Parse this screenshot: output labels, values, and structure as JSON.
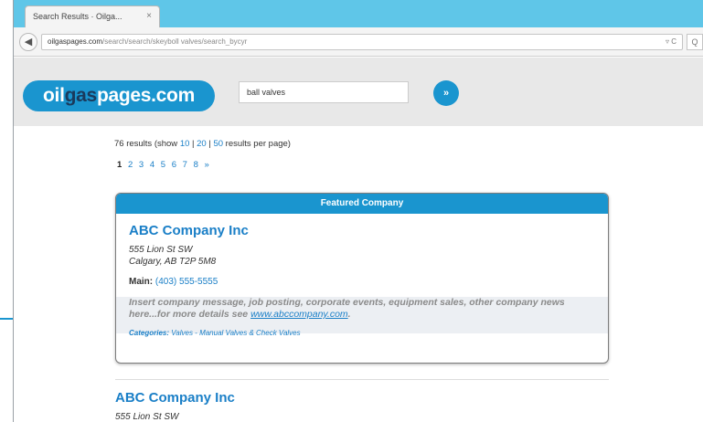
{
  "browser": {
    "tab_title": "Search Results · Oilga...",
    "tab_close": "×",
    "back_icon": "back-arrow-icon",
    "url_host": "oilgaspages.com",
    "url_path": "/search/search/skeyboll valves/search_bycyr",
    "url_tools": "▿ C",
    "url_extra": "Q"
  },
  "site": {
    "logo_part1": "oil",
    "logo_part2": "gas",
    "logo_part3": "pages.com",
    "search_value": "ball valves",
    "search_go_icon": "»",
    "brand_color": "#1a95cf"
  },
  "results": {
    "summary_prefix": "76 results (show ",
    "per_page": [
      "10",
      "20",
      "50"
    ],
    "sep": " | ",
    "summary_suffix": " results per page)",
    "pages": [
      "1",
      "2",
      "3",
      "4",
      "5",
      "6",
      "7",
      "8",
      "»"
    ]
  },
  "featured": {
    "header": "Featured Company",
    "company_name": "ABC Company Inc",
    "address_line1": "555 Lion St SW",
    "address_line2": "Calgary, AB  T2P 5M8",
    "phone_label": "Main:",
    "phone_value": "(403) 555-5555",
    "message": "Insert company message, job posting, corporate events, equipment sales, other company news here...for more details see ",
    "message_link": "www.abccompany.com",
    "message_end": ".",
    "categories_label": "Categories:",
    "categories_value": " Valves - Manual Valves & Check Valves"
  },
  "result2": {
    "company_name": "ABC Company Inc",
    "address_line1": "555 Lion St SW"
  }
}
